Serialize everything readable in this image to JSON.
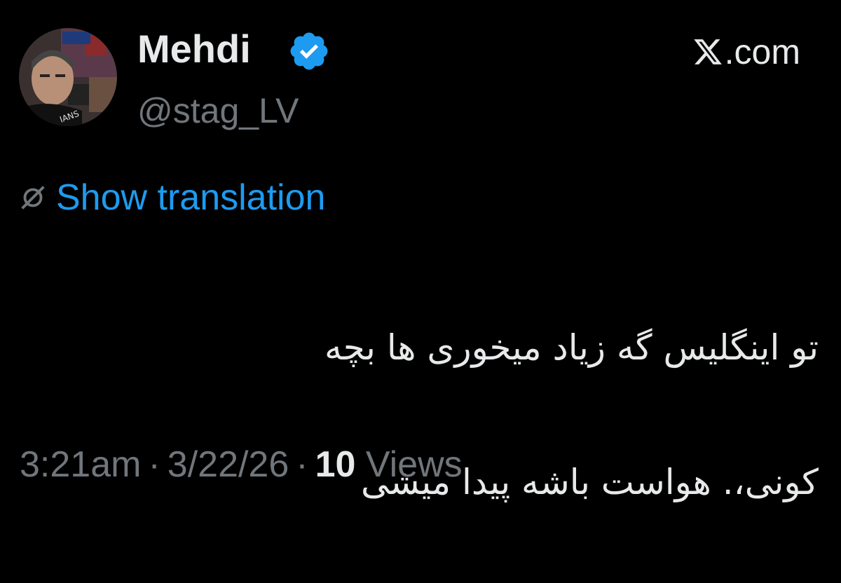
{
  "author": {
    "display_name": "Mehdi",
    "handle": "@stag_LV",
    "verified": true
  },
  "source": {
    "label": ".com",
    "logo_icon": "x-logo-icon"
  },
  "translation": {
    "label": "Show translation",
    "icon": "globe-icon"
  },
  "tweet": {
    "text_line1": "تو اینگلیس گه زیاد میخوری ها بچه",
    "text_line2": "کونی،. هواست باشه پیدا میشی"
  },
  "meta": {
    "time": "3:21am",
    "separator": "·",
    "date": "3/22/26",
    "views_count": "10",
    "views_label": "Views"
  },
  "colors": {
    "background": "#000000",
    "primary_text": "#e7e9ea",
    "secondary_text": "#71767b",
    "link_blue": "#1d9bf0",
    "verified_blue": "#1d9bf0"
  }
}
